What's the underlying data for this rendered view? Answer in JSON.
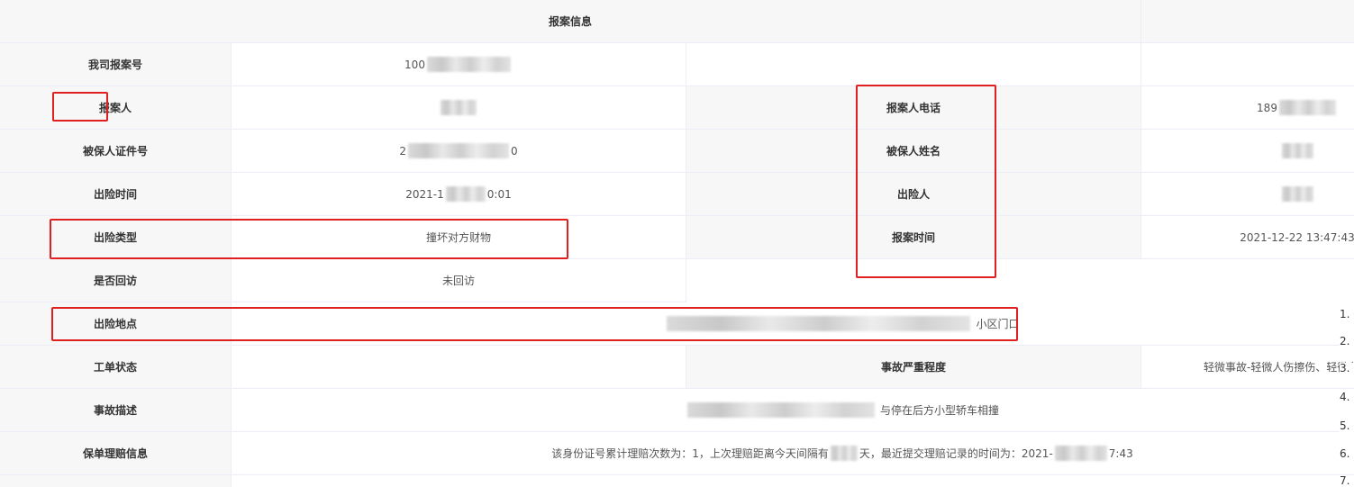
{
  "section": {
    "title": "报案信息"
  },
  "fields": {
    "report_no": {
      "label": "我司报案号",
      "value_prefix": "100"
    },
    "reporter": {
      "label": "报案人"
    },
    "reporter_phone": {
      "label": "报案人电话",
      "value_prefix": "189"
    },
    "insured_id_no": {
      "label": "被保人证件号",
      "value_prefix": "2",
      "value_suffix": "0"
    },
    "insured_name": {
      "label": "被保人姓名"
    },
    "accident_time": {
      "label": "出险时间",
      "value_prefix": "2021-1",
      "value_suffix": "0:01"
    },
    "accident_person": {
      "label": "出险人"
    },
    "accident_type": {
      "label": "出险类型",
      "value": "撞坏对方财物"
    },
    "report_time": {
      "label": "报案时间",
      "value": "2021-12-22 13:47:43"
    },
    "callback": {
      "label": "是否回访",
      "value": "未回访"
    },
    "accident_location": {
      "label": "出险地点",
      "value_suffix": "小区门口"
    },
    "work_order_status": {
      "label": "工单状态"
    },
    "accident_severity": {
      "label": "事故严重程度",
      "value": "轻微事故-轻微人伤擦伤、轻微车"
    },
    "accident_description": {
      "label": "事故描述",
      "value_suffix": "与停在后方小型轿车相撞"
    },
    "claim_history": {
      "label": "保单理赔信息",
      "value_part1": "该身份证号累计理赔次数为：1，上次理赔距离今天间隔有",
      "value_part2": "天，最近提交理赔记录的时间为：2021-",
      "value_part3": "7:43"
    }
  },
  "popup_list": {
    "items": [
      "1.",
      "2.",
      "3.",
      "4.",
      "5.",
      "6.",
      "7."
    ]
  },
  "colors": {
    "label_bg": "#f7f7f7",
    "border": "#ebeef5",
    "annotation": "#e02020"
  }
}
